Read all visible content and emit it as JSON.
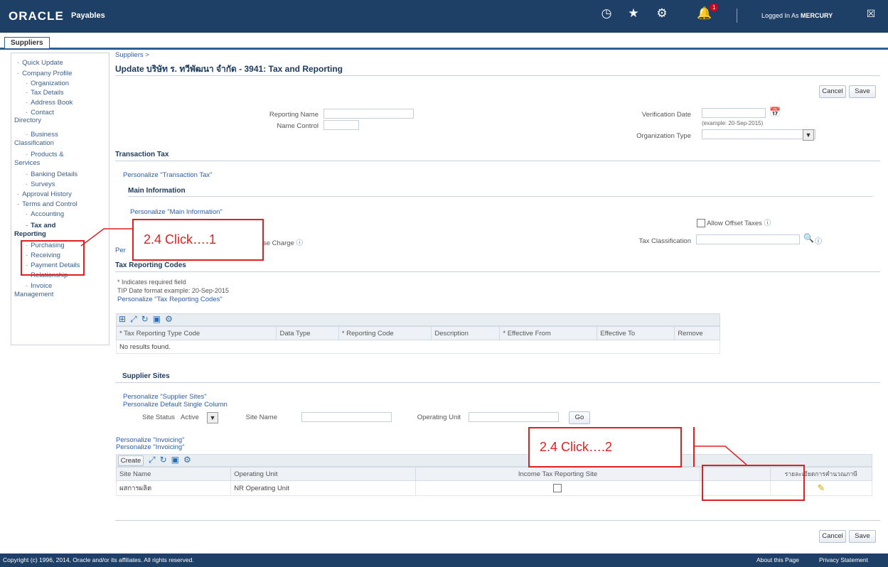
{
  "header": {
    "logo": "ORACLE",
    "app_name": "Payables",
    "notif_count": "1",
    "logged_in_prefix": "Logged In As ",
    "logged_in_user": "MERCURY"
  },
  "tabs": [
    "Suppliers"
  ],
  "sidenav": [
    {
      "label": "Quick Update"
    },
    {
      "label": "Company Profile"
    },
    {
      "label": "Organization"
    },
    {
      "label": "Tax Details"
    },
    {
      "label": "Address Book"
    },
    {
      "label": "Contact"
    },
    {
      "label": "Directory"
    },
    {
      "label": "Business"
    },
    {
      "label": "Classification"
    },
    {
      "label": "Products &"
    },
    {
      "label": "Services"
    },
    {
      "label": "Banking Details"
    },
    {
      "label": "Surveys"
    },
    {
      "label": "Approval History"
    },
    {
      "label": "Terms and Control"
    },
    {
      "label": "Accounting"
    },
    {
      "label": "Tax and"
    },
    {
      "label": "Reporting"
    },
    {
      "label": "Purchasing"
    },
    {
      "label": "Receiving"
    },
    {
      "label": "Payment Details"
    },
    {
      "label": "Relationship"
    },
    {
      "label": "Invoice"
    },
    {
      "label": "Management"
    }
  ],
  "main": {
    "breadcrumb": "Suppliers >",
    "title": "Update บริษัท ร. ทวีพัฒนา จำกัด - 3941: Tax and Reporting",
    "cancel": "Cancel",
    "save": "Save",
    "reporting_name_label": "Reporting Name",
    "name_control_label": "Name Control",
    "verification_date_label": "Verification Date",
    "date_example": "(example: 20-Sep-2015)",
    "organization_type_label": "Organization Type",
    "transaction_tax": "Transaction Tax",
    "personalize_tt": "Personalize \"Transaction Tax\"",
    "main_information": "Main Information",
    "personalize_mi": "Personalize \"Main Information\"",
    "reverse_charge": "se Charge",
    "allow_offset": "Allow Offset Taxes",
    "tax_classification": "Tax Classification",
    "per_fragment": "Per",
    "tax_reporting_codes": "Tax Reporting Codes",
    "required_note": "* Indicates required field",
    "tip": "TIP Date format example: 20-Sep-2015",
    "personalize_trc": "Personalize \"Tax Reporting Codes\"",
    "trc_columns": [
      "* Tax Reporting Type Code",
      "Data Type",
      "* Reporting Code",
      "Description",
      "* Effective From",
      "Effective To",
      "Remove"
    ],
    "no_results": "No results found.",
    "supplier_sites": "Supplier Sites",
    "personalize_ss": "Personalize \"Supplier Sites\"",
    "personalize_dsc": "Personalize Default Single Column",
    "site_status_label": "Site Status",
    "site_status_value": "Active",
    "site_name_label": "Site Name",
    "operating_unit_label": "Operating Unit",
    "go": "Go",
    "personalize_inv1": "Personalize \"Invoicing\"",
    "personalize_inv2": "Personalize \"Invoicing\"",
    "create": "Create",
    "sites_columns": [
      "Site Name",
      "Operating Unit",
      "Income Tax Reporting Site",
      "",
      "รายละเอียดการคำนวณภาษี"
    ],
    "sites_row": {
      "site_name": "ผสการผลิต",
      "operating_unit": "NR Operating Unit"
    }
  },
  "annotations": {
    "callout1": "2.4 Click….1",
    "callout2": "2.4 Click….2"
  },
  "footer": {
    "copyright": "Copyright (c) 1996, 2014, Oracle and/or its affiliates. All rights reserved.",
    "about": "About this Page",
    "privacy": "Privacy Statement"
  },
  "colors": {
    "header": "#1e3f66",
    "annotation": "#e02020",
    "link": "#2a5db0"
  }
}
